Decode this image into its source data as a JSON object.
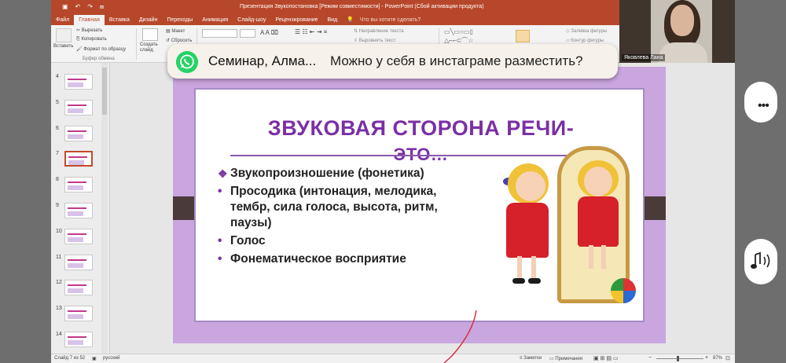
{
  "window": {
    "title": "Презентация Звукопостановка [Режим совместимости] - PowerPoint (Сбой активации продукта)"
  },
  "menu": {
    "tabs": [
      "Файл",
      "Главная",
      "Вставка",
      "Дизайн",
      "Переходы",
      "Анимация",
      "Слайд-шоу",
      "Рецензирование",
      "Вид"
    ],
    "active_index": 1,
    "tell_me": "Что вы хотите сделать?"
  },
  "ribbon": {
    "paste": "Вставить",
    "cut": "Вырезать",
    "copy": "Копировать",
    "format_painter": "Формат по образцу",
    "clipboard_group": "Буфер обмена",
    "new_slide": "Создать слайд",
    "layout": "Макет",
    "reset": "Сбросить",
    "text_direction": "Направление текста",
    "align_text": "Выровнять текст",
    "shape_fill": "Заливка фигуры",
    "shape_outline": "Контур фигуры"
  },
  "thumbnails": [
    {
      "num": "4"
    },
    {
      "num": "5"
    },
    {
      "num": "6"
    },
    {
      "num": "7",
      "selected": true
    },
    {
      "num": "8"
    },
    {
      "num": "9"
    },
    {
      "num": "10"
    },
    {
      "num": "11"
    },
    {
      "num": "12"
    },
    {
      "num": "13"
    },
    {
      "num": "14"
    }
  ],
  "slide": {
    "title_line1": "ЗВУКОВАЯ СТОРОНА РЕЧИ-",
    "title_line2": "ЭТО…",
    "bullets": [
      {
        "marker": "❖",
        "text": "Звукопроизношение (фонетика)"
      },
      {
        "marker": "•",
        "text": "Просодика (интонация, мелодика, тембр, сила голоса, высота,  ритм, паузы)"
      },
      {
        "marker": "•",
        "text": "Голос"
      },
      {
        "marker": "•",
        "text": "Фонематическое восприятие"
      }
    ],
    "title_color": "#7b2fa5"
  },
  "notification": {
    "app_icon": "whatsapp-icon",
    "sender": "Семинар, Алма...",
    "message": "Можно у себя в инстаграме разместить?"
  },
  "status": {
    "slide_counter": "Слайд 7 из 52",
    "language": "русский",
    "notes": "Заметки",
    "comments": "Примечания",
    "zoom": "87%"
  },
  "video": {
    "participant_name": "Яковлева Лана"
  },
  "controls": {
    "more_icon": "more-dots-icon",
    "audio_icon": "speaker-icon"
  }
}
